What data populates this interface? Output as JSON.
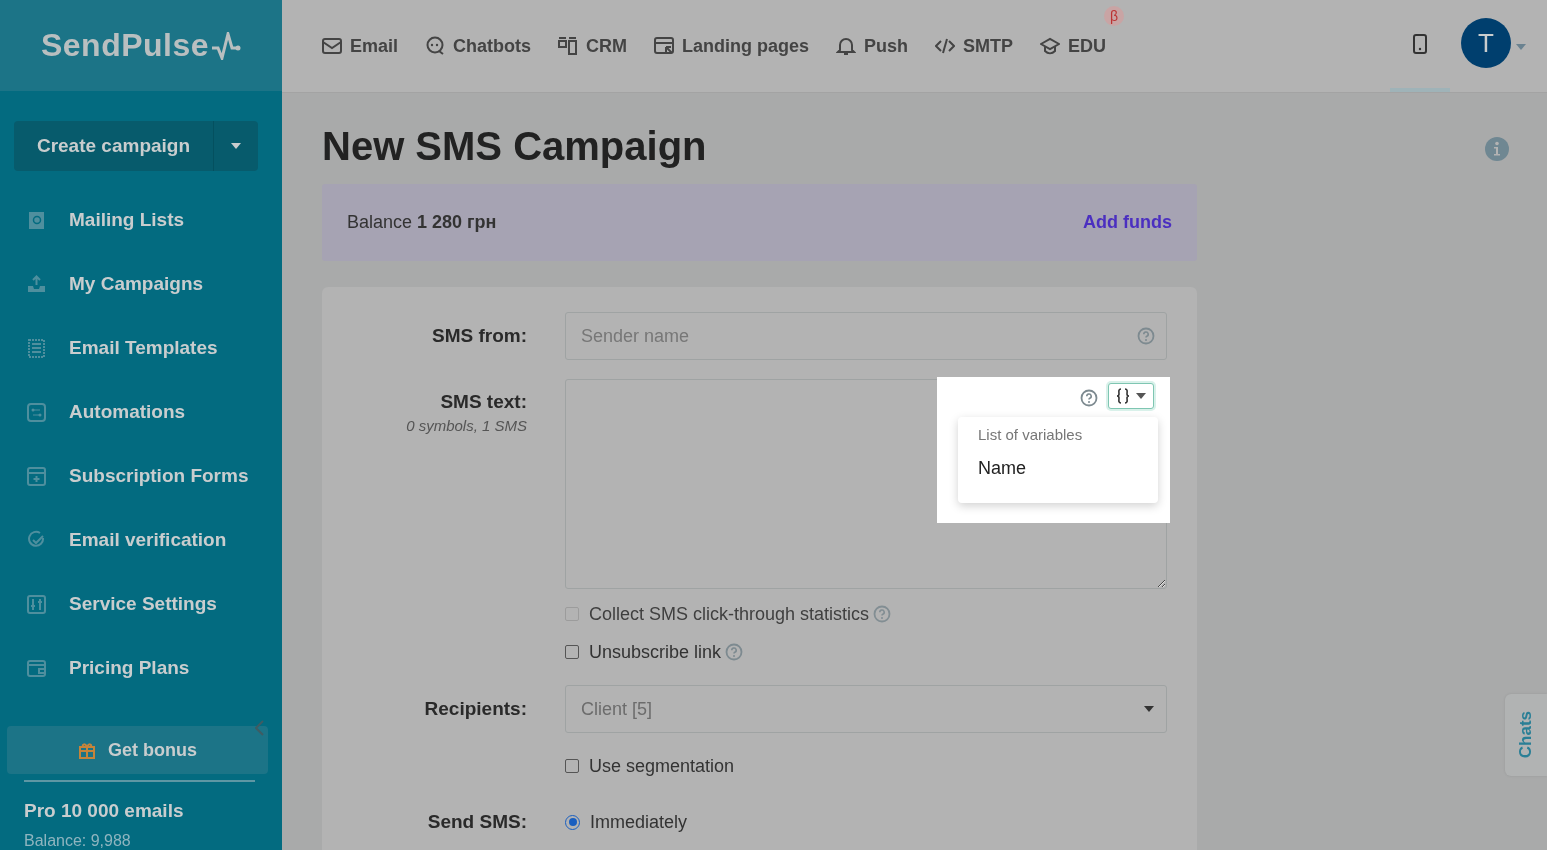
{
  "logo": "SendPulse",
  "nav": [
    {
      "label": "Email"
    },
    {
      "label": "Chatbots"
    },
    {
      "label": "CRM"
    },
    {
      "label": "Landing pages"
    },
    {
      "label": "Push"
    },
    {
      "label": "SMTP"
    },
    {
      "label": "EDU",
      "badge": "β"
    }
  ],
  "avatar": "T",
  "sidebar": {
    "create_button": "Create campaign",
    "items": [
      {
        "label": "Mailing Lists"
      },
      {
        "label": "My Campaigns"
      },
      {
        "label": "Email Templates"
      },
      {
        "label": "Automations"
      },
      {
        "label": "Subscription Forms"
      },
      {
        "label": "Email verification"
      },
      {
        "label": "Service Settings"
      },
      {
        "label": "Pricing Plans"
      }
    ],
    "bonus_button": "Get bonus",
    "plan": "Pro 10 000 emails",
    "balance": "Balance: 9,988"
  },
  "page_title": "New SMS Campaign",
  "balance_bar": {
    "label": "Balance",
    "amount": "1 280 грн",
    "link": "Add funds"
  },
  "form": {
    "sms_from": {
      "label": "SMS from:",
      "placeholder": "Sender name"
    },
    "sms_text": {
      "label": "SMS text:",
      "counter": "0 symbols, 1 SMS",
      "variables_menu": {
        "header": "List of variables",
        "items": [
          "Name"
        ]
      }
    },
    "options": [
      {
        "label": "Collect SMS click-through statistics",
        "checked": false,
        "disabled": true
      },
      {
        "label": "Unsubscribe link",
        "checked": false,
        "disabled": false
      }
    ],
    "recipients": {
      "label": "Recipients:",
      "value": "Client [5]"
    },
    "segmentation": {
      "label": "Use segmentation",
      "checked": false
    },
    "send": {
      "label": "Send SMS:",
      "options": [
        {
          "label": "Immediately",
          "selected": true
        }
      ]
    }
  },
  "chats_tab": "Chats"
}
